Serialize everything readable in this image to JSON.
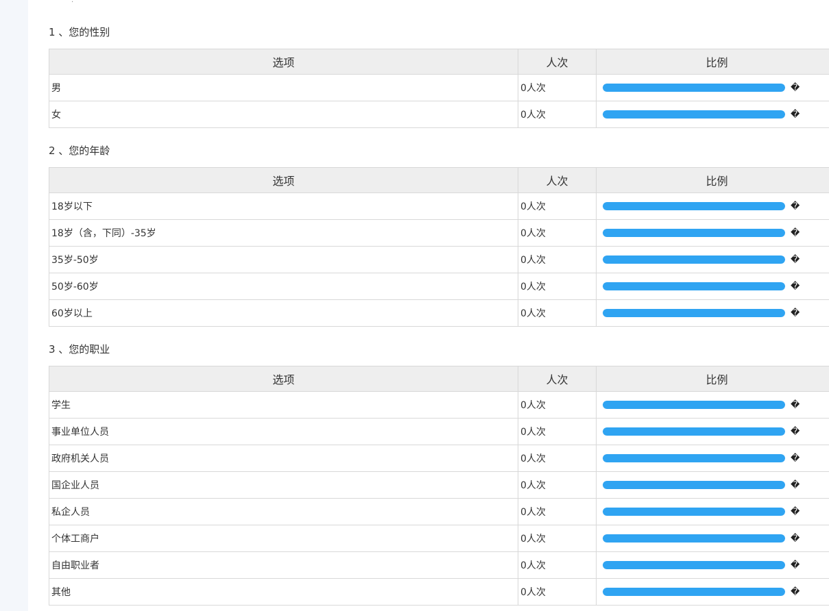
{
  "header_mark": "·",
  "bar_color": "#2fa4f2",
  "sections": [
    {
      "title": "1 、您的性别",
      "columns": [
        "选项",
        "人次",
        "比例"
      ],
      "rows": [
        {
          "option": "男",
          "count": "0人次",
          "fill": 1.0,
          "pct": "�"
        },
        {
          "option": "女",
          "count": "0人次",
          "fill": 1.0,
          "pct": "�"
        }
      ]
    },
    {
      "title": "2 、您的年龄",
      "columns": [
        "选项",
        "人次",
        "比例"
      ],
      "rows": [
        {
          "option": "18岁以下",
          "count": "0人次",
          "fill": 1.0,
          "pct": "�"
        },
        {
          "option": "18岁（含，下同）-35岁",
          "count": "0人次",
          "fill": 1.0,
          "pct": "�"
        },
        {
          "option": "35岁-50岁",
          "count": "0人次",
          "fill": 1.0,
          "pct": "�"
        },
        {
          "option": "50岁-60岁",
          "count": "0人次",
          "fill": 1.0,
          "pct": "�"
        },
        {
          "option": "60岁以上",
          "count": "0人次",
          "fill": 1.0,
          "pct": "�"
        }
      ]
    },
    {
      "title": "3 、您的职业",
      "columns": [
        "选项",
        "人次",
        "比例"
      ],
      "rows": [
        {
          "option": "学生",
          "count": "0人次",
          "fill": 1.0,
          "pct": "�"
        },
        {
          "option": "事业单位人员",
          "count": "0人次",
          "fill": 1.0,
          "pct": "�"
        },
        {
          "option": "政府机关人员",
          "count": "0人次",
          "fill": 1.0,
          "pct": "�"
        },
        {
          "option": "国企业人员",
          "count": "0人次",
          "fill": 1.0,
          "pct": "�"
        },
        {
          "option": "私企人员",
          "count": "0人次",
          "fill": 1.0,
          "pct": "�"
        },
        {
          "option": "个体工商户",
          "count": "0人次",
          "fill": 1.0,
          "pct": "�"
        },
        {
          "option": "自由职业者",
          "count": "0人次",
          "fill": 1.0,
          "pct": "�"
        },
        {
          "option": "其他",
          "count": "0人次",
          "fill": 1.0,
          "pct": "�"
        }
      ]
    }
  ]
}
